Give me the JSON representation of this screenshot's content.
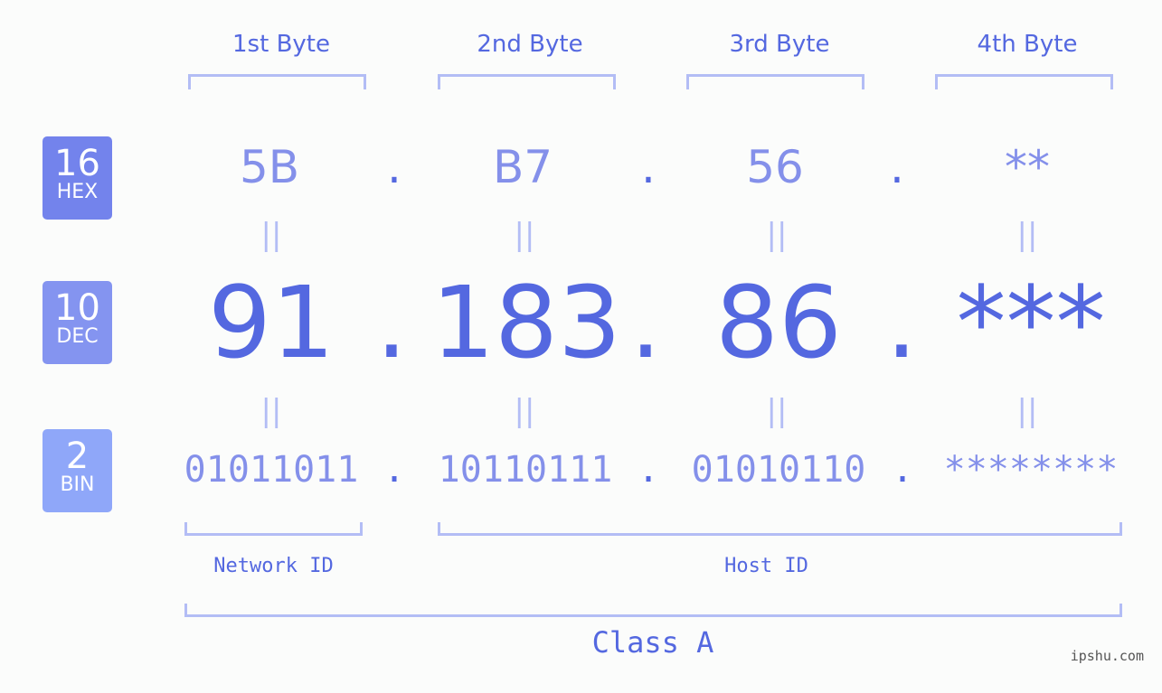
{
  "headers": [
    "1st Byte",
    "2nd Byte",
    "3rd Byte",
    "4th Byte"
  ],
  "badges": [
    {
      "number": "16",
      "label": "HEX",
      "color": "#7383ec"
    },
    {
      "number": "10",
      "label": "DEC",
      "color": "#8494f0"
    },
    {
      "number": "2",
      "label": "BIN",
      "color": "#8fa7f9"
    }
  ],
  "hex": [
    "5B",
    "B7",
    "56",
    "**"
  ],
  "dec": [
    "91",
    "183",
    "86",
    "***"
  ],
  "bin": [
    "01011011",
    "10110111",
    "01010110",
    "********"
  ],
  "separator": ".",
  "equals": "||",
  "network_label": "Network ID",
  "host_label": "Host ID",
  "class_label": "Class A",
  "watermark": "ipshu.com"
}
